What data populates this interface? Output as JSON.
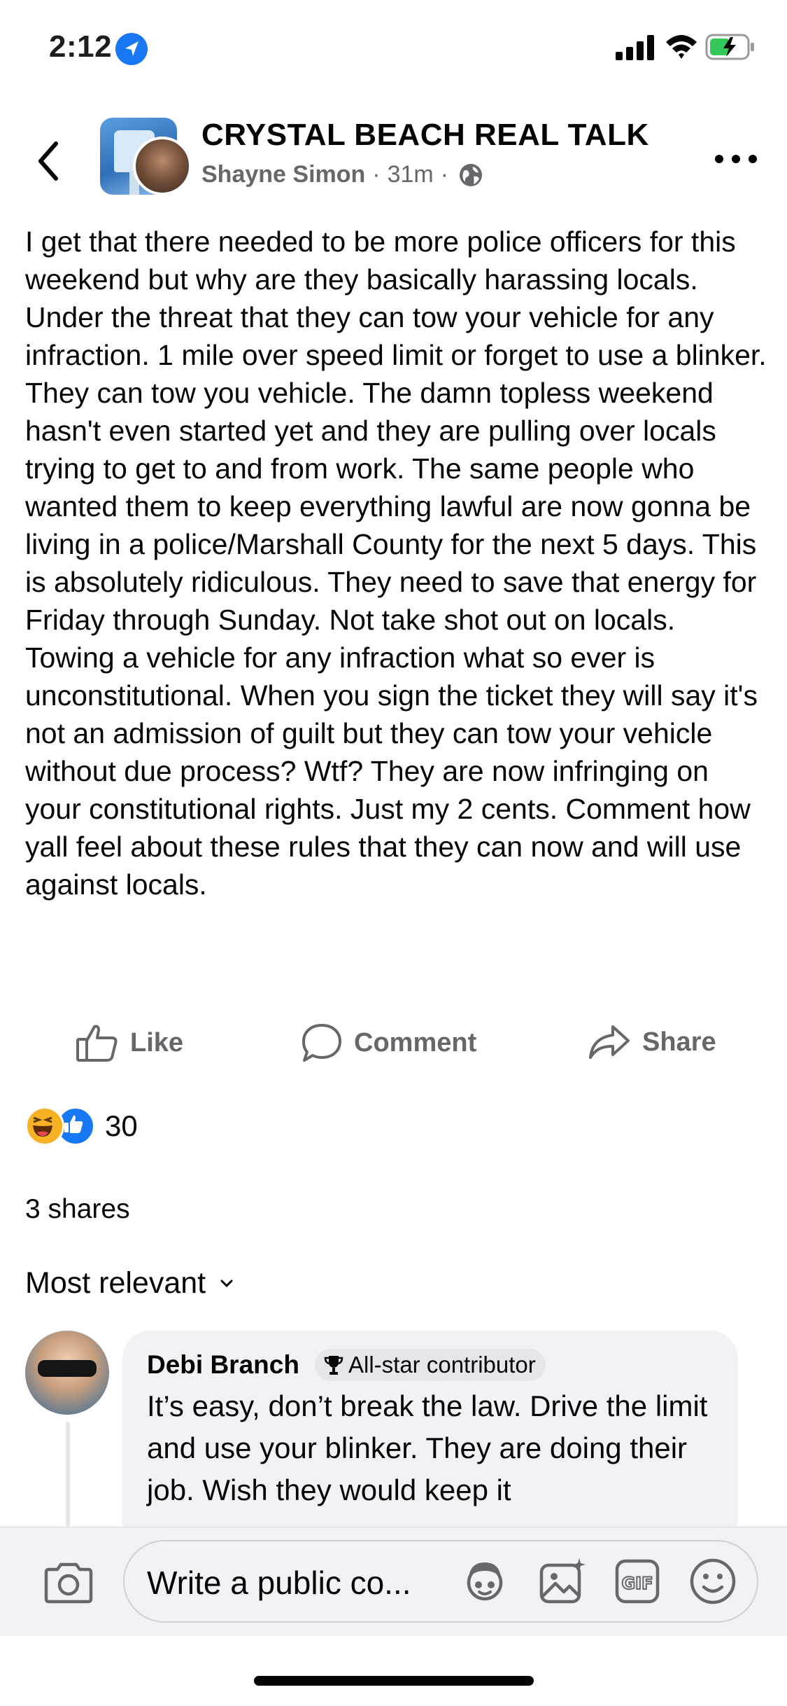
{
  "status_bar": {
    "time": "2:12",
    "icons": [
      "location-arrow-icon",
      "cellular-signal-icon",
      "wifi-icon",
      "battery-charging-icon"
    ]
  },
  "header": {
    "group_name": "CRYSTAL BEACH REAL TALK",
    "author": "Shayne Simon",
    "time_ago": "31m",
    "separator": "·",
    "audience_icon": "globe-icon",
    "back_icon": "chevron-left-icon",
    "more_icon": "more-horizontal-icon"
  },
  "post": {
    "text": "I get that there needed to be more police officers for this weekend but why are they basically harassing locals. Under the threat that they can tow your vehicle for any infraction. 1 mile over speed limit or forget to use a blinker. They can tow you vehicle. The damn topless weekend hasn't even started yet and they are pulling over locals trying to get to and from work. The same people who wanted them to keep everything lawful are now gonna be living in a police/Marshall County for the next 5 days. This is absolutely ridiculous. They need to save that energy for Friday through Sunday. Not take shot out on locals. Towing a vehicle for any infraction what so ever is unconstitutional. When you sign the ticket they will say it's not an admission of guilt but they can tow your vehicle without due process? Wtf? They are now infringing on your constitutional rights. Just my 2 cents. Comment how yall feel about these rules that they can now and will use against locals."
  },
  "actions": {
    "like_label": "Like",
    "comment_label": "Comment",
    "share_label": "Share"
  },
  "reactions": {
    "types": [
      "haha",
      "like"
    ],
    "count": "30"
  },
  "shares_text": "3 shares",
  "sort_label": "Most relevant",
  "comment": {
    "author": "Debi Branch",
    "badge": "All-star contributor",
    "text": "It’s easy, don’t break the law. Drive the limit and use your blinker.  They are doing their job. Wish they would keep it"
  },
  "composer": {
    "placeholder": "Write a public co...",
    "icons": [
      "camera-icon",
      "avatar-sticker-icon",
      "photo-icon",
      "gif-icon",
      "emoji-icon"
    ]
  },
  "colors": {
    "text_primary": "#050505",
    "text_secondary": "#65676b",
    "brand_blue": "#1877f2",
    "bubble_bg": "#f0f2f5",
    "haha_yellow": "#f7b125",
    "battery_green": "#34c759"
  }
}
